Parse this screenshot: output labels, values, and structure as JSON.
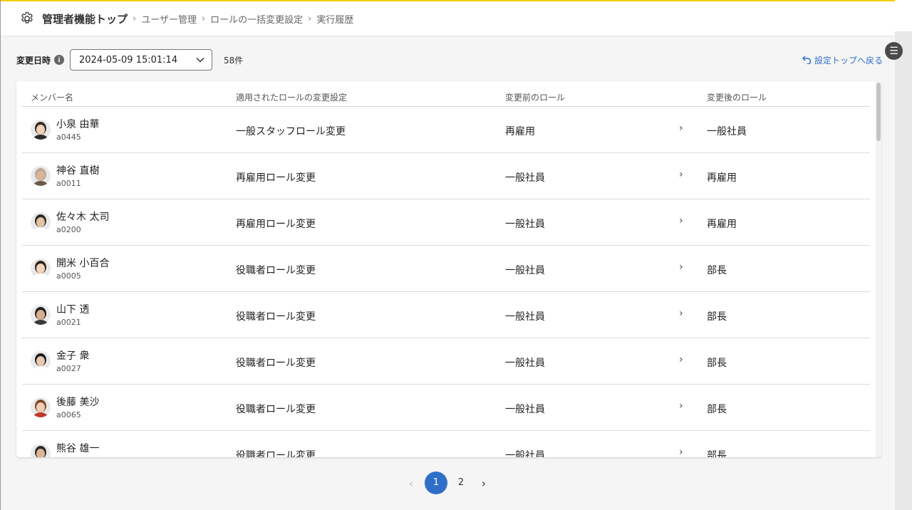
{
  "header": {
    "title": "管理者機能トップ",
    "breadcrumbs": [
      "ユーザー管理",
      "ロールの一括変更設定",
      "実行履歴"
    ]
  },
  "toolbar": {
    "date_label": "変更日時",
    "selected_date": "2024-05-09 15:01:14",
    "count": "58件",
    "back_link": "設定トップへ戻る"
  },
  "table": {
    "columns": [
      "メンバー名",
      "適用されたロールの変更設定",
      "変更前のロール",
      "変更後のロール"
    ],
    "rows": [
      {
        "name": "小泉 由華",
        "id": "a0445",
        "setting": "一般スタッフロール変更",
        "before": "再雇用",
        "after": "一般社員",
        "avatar": "female-avatar-icon",
        "hair": "#3a2a20",
        "skin": "#f1d2b8",
        "shirt": "#2b2b2b"
      },
      {
        "name": "神谷 直樹",
        "id": "a0011",
        "setting": "再雇用ロール変更",
        "before": "一般社員",
        "after": "再雇用",
        "avatar": "male-avatar-icon",
        "hair": "#b9a89a",
        "skin": "#d9b49a",
        "shirt": "#6b5a4a"
      },
      {
        "name": "佐々木 太司",
        "id": "a0200",
        "setting": "再雇用ロール変更",
        "before": "一般社員",
        "after": "再雇用",
        "avatar": "male-avatar-icon",
        "hair": "#2a2a2a",
        "skin": "#e6c1a2",
        "shirt": "#ffffff"
      },
      {
        "name": "開米 小百合",
        "id": "a0005",
        "setting": "役職者ロール変更",
        "before": "一般社員",
        "after": "部長",
        "avatar": "female-avatar-icon",
        "hair": "#2e241e",
        "skin": "#f2d4bc",
        "shirt": "#ffffff"
      },
      {
        "name": "山下 透",
        "id": "a0021",
        "setting": "役職者ロール変更",
        "before": "一般社員",
        "after": "部長",
        "avatar": "male-avatar-icon",
        "hair": "#1f1f1f",
        "skin": "#d8ae8e",
        "shirt": "#3a3a3a"
      },
      {
        "name": "金子 衆",
        "id": "a0027",
        "setting": "役職者ロール変更",
        "before": "一般社員",
        "after": "部長",
        "avatar": "male-avatar-icon",
        "hair": "#1a1a1a",
        "skin": "#e9c8ad",
        "shirt": "#ffffff"
      },
      {
        "name": "後藤 美沙",
        "id": "a0065",
        "setting": "役職者ロール変更",
        "before": "一般社員",
        "after": "部長",
        "avatar": "female-avatar-icon",
        "hair": "#7a4a2a",
        "skin": "#f0cdb4",
        "shirt": "#c0392b"
      },
      {
        "name": "熊谷 雄一",
        "id": "",
        "setting": "役職者ロール変更",
        "before": "一般社員",
        "after": "部長",
        "avatar": "male-avatar-icon",
        "hair": "#2a2a2a",
        "skin": "#ddb496",
        "shirt": "#444444"
      }
    ]
  },
  "pagination": {
    "pages": [
      "1",
      "2"
    ],
    "current": "1"
  },
  "colors": {
    "accent": "#2f6fc9",
    "header_border": "#f5d000"
  }
}
